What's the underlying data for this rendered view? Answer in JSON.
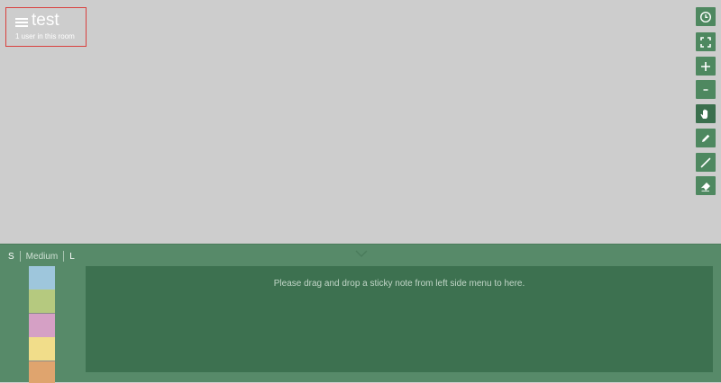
{
  "room": {
    "title": "test",
    "users_text": "1 user in this room"
  },
  "toolbar": {
    "tools": [
      {
        "name": "history",
        "icon": "clock-icon"
      },
      {
        "name": "fullscreen",
        "icon": "fullscreen-icon"
      },
      {
        "name": "zoom-in",
        "icon": "plus-icon"
      },
      {
        "name": "zoom-out",
        "icon": "minus-icon"
      },
      {
        "name": "pan",
        "icon": "hand-icon",
        "active": true
      },
      {
        "name": "pen",
        "icon": "pencil-icon"
      },
      {
        "name": "line",
        "icon": "line-icon"
      },
      {
        "name": "eraser",
        "icon": "eraser-icon"
      }
    ]
  },
  "sticky_panel": {
    "sizes": [
      "S",
      "Medium",
      "L"
    ],
    "selected_size": "Medium",
    "colors": [
      "#9ec6dc",
      "#b5c97f",
      "#d5a0c5",
      "#f1dd8a",
      "#dfa46e"
    ],
    "drop_hint": "Please drag and drop a sticky note from left side menu to here."
  }
}
